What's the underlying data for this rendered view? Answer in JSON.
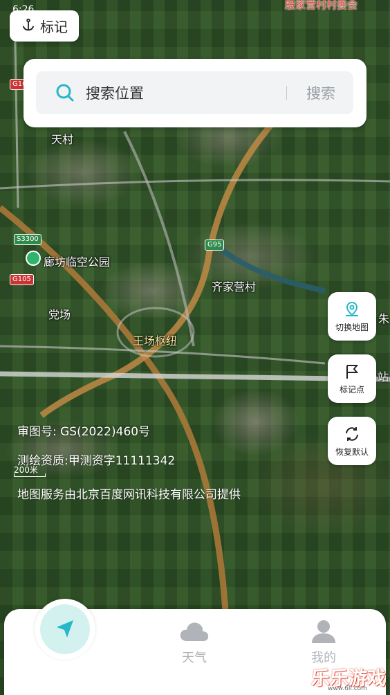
{
  "status": {
    "time": "6:26"
  },
  "map": {
    "poi_top": "殷家营村村委会",
    "mark_label": "标记",
    "labels": {
      "tiancun": "天村",
      "park": "廊坊临空公园",
      "qijiaying": "齐家营村",
      "dangchang": "党场",
      "wangchang_hub": "王场枢纽",
      "zhu": "朱",
      "zhan": "站"
    },
    "road_badges": {
      "g105_top": "G10",
      "s3300": "S3300",
      "g95": "G95",
      "g105": "G105"
    },
    "scale": "200米"
  },
  "search": {
    "placeholder": "搜索位置",
    "button": "搜索"
  },
  "side_buttons": {
    "switch_map": "切换地图",
    "mark_point": "标记点",
    "restore_default": "恢复默认"
  },
  "info": {
    "review_number": "审图号: GS(2022)460号",
    "survey_qualification": "测绘资质:甲测资字11111342",
    "service_provider": "地图服务由北京百度网讯科技有限公司提供"
  },
  "tabs": {
    "weather": "天气",
    "mine": "我的"
  },
  "watermark": {
    "text": "乐乐游戏",
    "url": "www.6ll.com"
  },
  "colors": {
    "accent": "#27b7c9",
    "poi_red": "#e04b3a",
    "road_orange": "#c98a3a"
  }
}
